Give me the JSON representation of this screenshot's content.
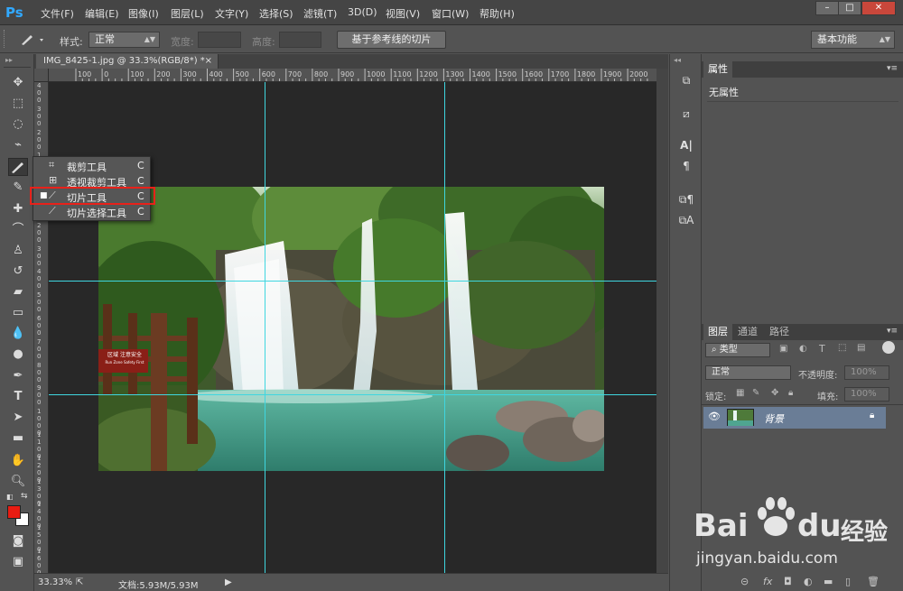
{
  "app": {
    "logo": "Ps"
  },
  "menu": [
    "文件(F)",
    "编辑(E)",
    "图像(I)",
    "图层(L)",
    "文字(Y)",
    "选择(S)",
    "滤镜(T)",
    "3D(D)",
    "视图(V)",
    "窗口(W)",
    "帮助(H)"
  ],
  "window_controls": {
    "minimize": "–",
    "maximize": "□",
    "close": "✕"
  },
  "options": {
    "style_label": "样式:",
    "style_value": "正常",
    "width_label": "宽度:",
    "height_label": "高度:",
    "slice_button": "基于参考线的切片",
    "workspace": "基本功能"
  },
  "document": {
    "tab_title": "IMG_8425-1.jpg @ 33.3%(RGB/8*) *",
    "tab_close": "×",
    "zoom": "33.33%",
    "doc_info": "文档:5.93M/5.93M"
  },
  "ruler": {
    "top_labels": [
      "100",
      "0",
      "100",
      "200",
      "300",
      "400",
      "500",
      "600",
      "700",
      "800",
      "900",
      "1000",
      "1100",
      "1200",
      "1300",
      "1400",
      "1500",
      "1600",
      "1700",
      "1800",
      "1900",
      "2000"
    ],
    "left_labels": [
      "4\n0\n0",
      "3\n0\n0",
      "2\n0\n0",
      "1\n0\n0",
      "0",
      "1\n0\n0",
      "2\n0\n0",
      "3\n0\n0",
      "4\n0\n0",
      "5\n0\n0",
      "6\n0\n0",
      "7\n0\n0",
      "8\n0\n0",
      "9\n0\n0",
      "1\n0\n0\n0",
      "1\n1\n0\n0",
      "1\n2\n0\n0",
      "1\n3\n0\n0",
      "1\n4\n0\n0",
      "1\n5\n0\n0",
      "1\n6\n0\n0"
    ]
  },
  "flyout": {
    "items": [
      {
        "label": "裁剪工具",
        "key": "C",
        "icon": "crop-icon"
      },
      {
        "label": "透视裁剪工具",
        "key": "C",
        "icon": "perspective-crop-icon"
      },
      {
        "label": "切片工具",
        "key": "C",
        "icon": "slice-icon",
        "selected": true
      },
      {
        "label": "切片选择工具",
        "key": "C",
        "icon": "slice-select-icon"
      }
    ]
  },
  "photo": {
    "sign_line1": "区域  注意安全",
    "sign_line2": "Run Zone Safety First"
  },
  "properties": {
    "tab": "属性",
    "content": "无属性"
  },
  "layers": {
    "tabs": [
      "图层",
      "通道",
      "路径"
    ],
    "filter_label": "类型",
    "blend_mode": "正常",
    "opacity_label": "不透明度:",
    "opacity_value": "100%",
    "lock_label": "锁定:",
    "fill_label": "填充:",
    "fill_value": "100%",
    "layer_name": "背景"
  },
  "watermark": {
    "brand": "Bai",
    "brand2": "du",
    "brand_cn": "经验",
    "url": "jingyan.baidu.com"
  },
  "colors": {
    "guide": "#3fd6e0",
    "highlight": "#e8211a",
    "foreground": "#e81c12",
    "background": "#ffffff"
  }
}
